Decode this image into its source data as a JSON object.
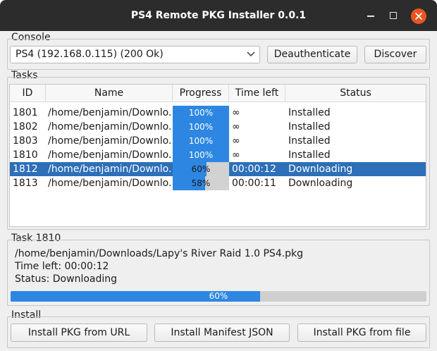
{
  "window": {
    "title": "PS4 Remote PKG Installer 0.0.1"
  },
  "console": {
    "label": "Console",
    "selected_device": "PS4 (192.168.0.115) (200 Ok)",
    "deauth_label": "Deauthenticate",
    "discover_label": "Discover"
  },
  "tasks": {
    "label": "Tasks",
    "columns": [
      "ID",
      "Name",
      "Progress",
      "Time left",
      "Status"
    ],
    "rows": [
      {
        "id": "1801",
        "name": "/home/benjamin/Downlo...",
        "progress": 100,
        "progress_text": "100%",
        "time_left": "∞",
        "status": "Installed",
        "selected": false
      },
      {
        "id": "1802",
        "name": "/home/benjamin/Downlo...",
        "progress": 100,
        "progress_text": "100%",
        "time_left": "∞",
        "status": "Installed",
        "selected": false
      },
      {
        "id": "1803",
        "name": "/home/benjamin/Downlo...",
        "progress": 100,
        "progress_text": "100%",
        "time_left": "∞",
        "status": "Installed",
        "selected": false
      },
      {
        "id": "1810",
        "name": "/home/benjamin/Downlo...",
        "progress": 100,
        "progress_text": "100%",
        "time_left": "∞",
        "status": "Installed",
        "selected": false
      },
      {
        "id": "1812",
        "name": "/home/benjamin/Downlo...",
        "progress": 60,
        "progress_text": "60%",
        "time_left": "00:00:12",
        "status": "Downloading",
        "selected": true
      },
      {
        "id": "1813",
        "name": "/home/benjamin/Downlo...",
        "progress": 58,
        "progress_text": "58%",
        "time_left": "00:00:11",
        "status": "Downloading",
        "selected": false
      }
    ]
  },
  "task_detail": {
    "label": "Task 1810",
    "path": "/home/benjamin/Downloads/Lapy's River Raid 1.0 PS4.pkg",
    "time_left": "Time left: 00:00:12",
    "status": "Status: Downloading",
    "progress": 60,
    "progress_text": "60%"
  },
  "install": {
    "label": "Install",
    "from_url_label": "Install PKG from URL",
    "manifest_label": "Install Manifest JSON",
    "from_file_label": "Install PKG from file"
  },
  "colors": {
    "accent": "#2d87e2",
    "selection": "#2d6fb8",
    "close_button": "#e95420"
  }
}
